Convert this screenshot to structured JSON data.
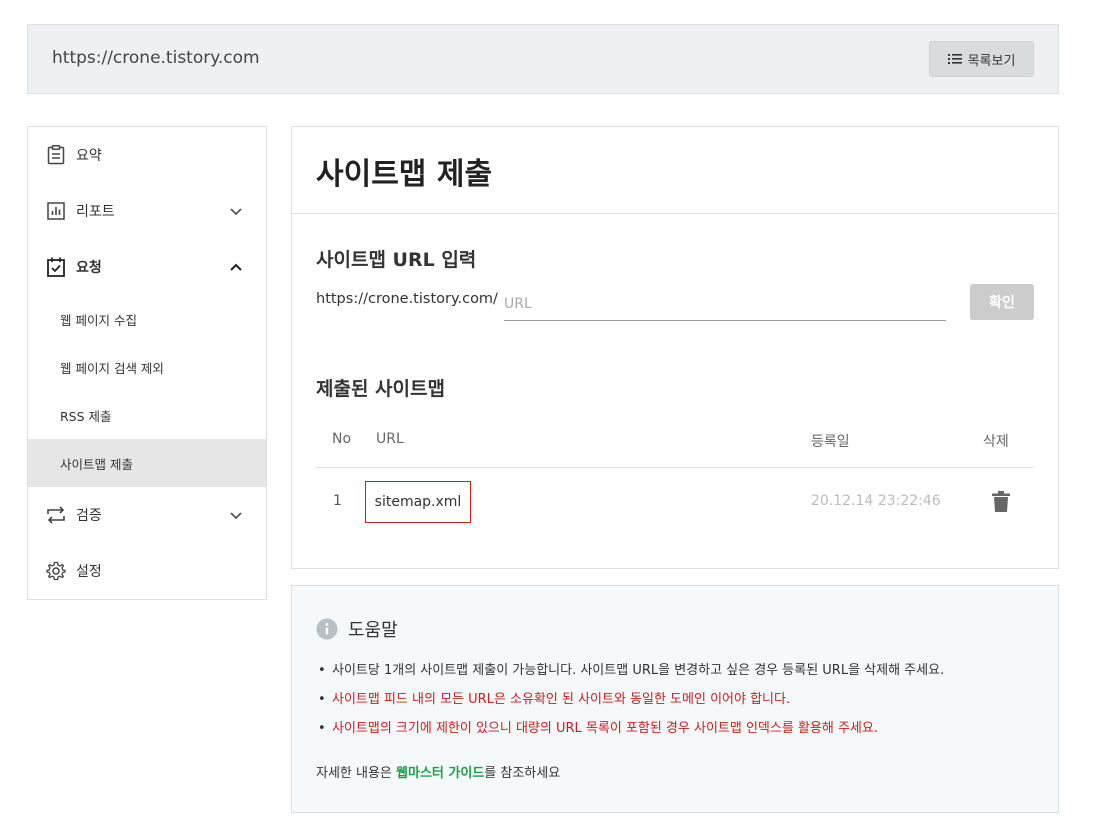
{
  "header": {
    "site_url": "https://crone.tistory.com",
    "list_button_label": "목록보기"
  },
  "sidebar": {
    "summary": "요약",
    "report": "리포트",
    "request": "요청",
    "request_sub": [
      "웹 페이지 수집",
      "웹 페이지 검색 제외",
      "RSS 제출",
      "사이트맵 제출"
    ],
    "verify": "검증",
    "settings": "설정"
  },
  "main": {
    "title": "사이트맵 제출",
    "url_section_title": "사이트맵 URL 입력",
    "url_prefix": "https://crone.tistory.com/",
    "url_placeholder": "URL",
    "url_value": "",
    "confirm_label": "확인",
    "submitted_title": "제출된 사이트맵",
    "columns": {
      "no": "No",
      "url": "URL",
      "date": "등록일",
      "delete": "삭제"
    },
    "rows": [
      {
        "no": "1",
        "url": "sitemap.xml",
        "date": "20.12.14 23:22:46"
      }
    ]
  },
  "help": {
    "title": "도움말",
    "items": [
      "사이트당 1개의 사이트맵 제출이 가능합니다. 사이트맵 URL을 변경하고 싶은 경우 등록된 URL을 삭제해 주세요.",
      "사이트맵 피드 내의 모든 URL은 소유확인 된 사이트와 동일한 도메인 이어야 합니다.",
      "사이트맵의 크기에 제한이 있으니 대량의 URL 목록이 포함된 경우 사이트맵 인덱스를 활용해 주세요."
    ],
    "footer_prefix": "자세한 내용은 ",
    "footer_link": "웹마스터 가이드",
    "footer_suffix": "를 참조하세요"
  },
  "colors": {
    "accent_red": "#c81e1e",
    "link_green": "#1aa04a",
    "active_bg": "#e6e6e6"
  },
  "icons": [
    "list-icon",
    "clipboard-icon",
    "chart-icon",
    "calendar-check-icon",
    "swap-icon",
    "gear-icon",
    "chevron-down-icon",
    "chevron-up-icon",
    "trash-icon",
    "info-icon"
  ]
}
